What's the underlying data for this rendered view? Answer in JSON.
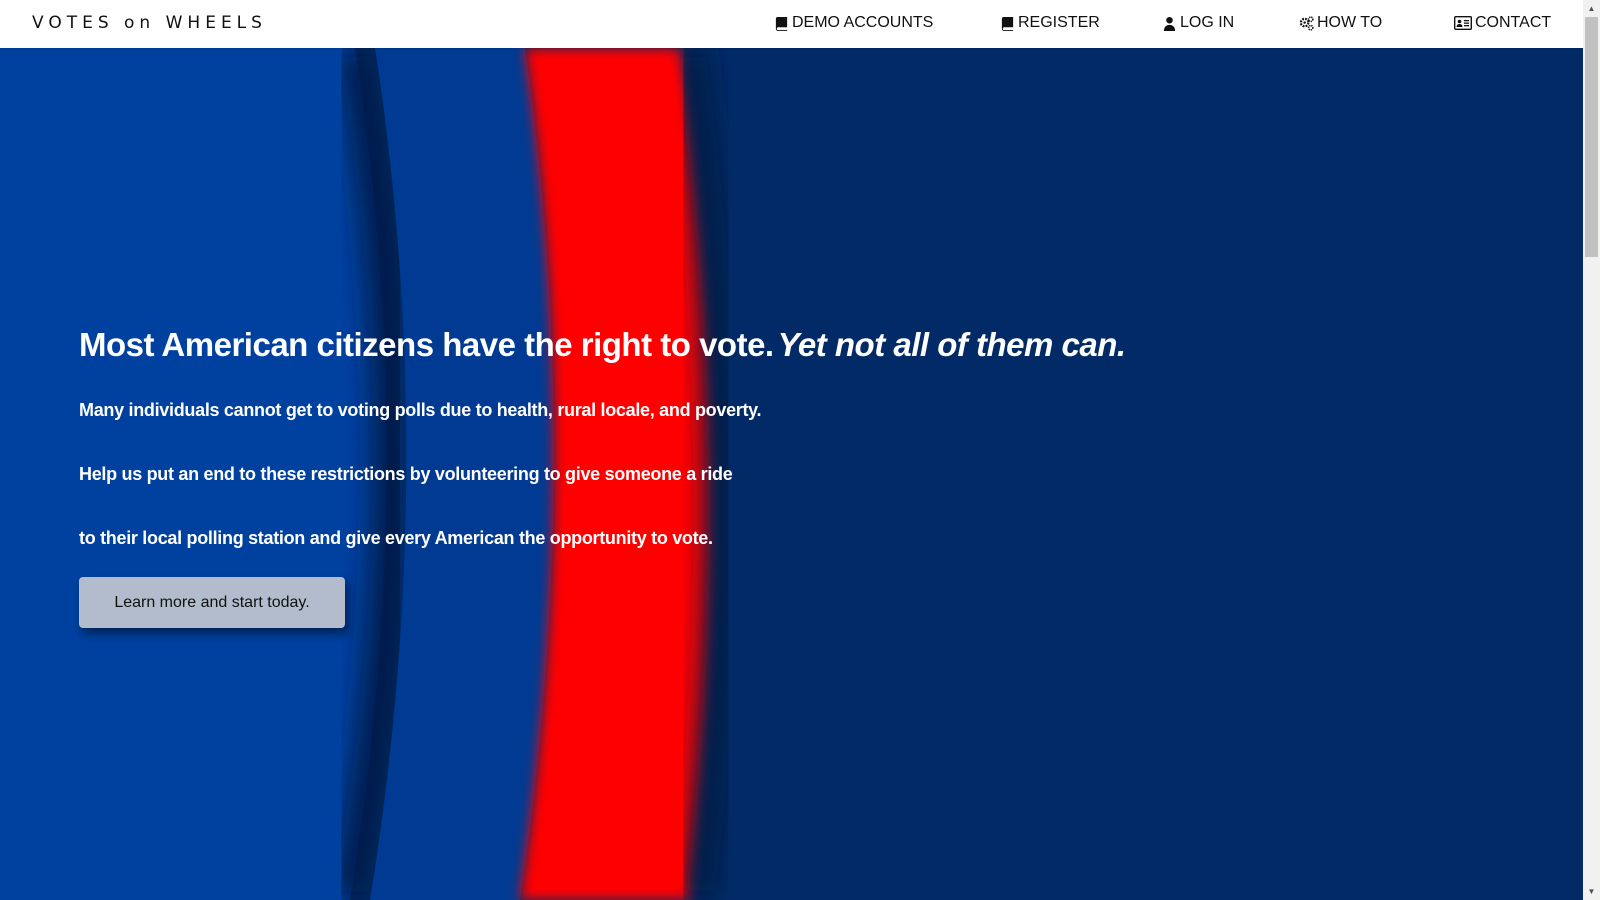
{
  "navbar": {
    "brand": "VOTES on WHEELS",
    "items": [
      {
        "label": "DEMO ACCOUNTS",
        "icon": "book-icon"
      },
      {
        "label": "REGISTER",
        "icon": "book-icon"
      },
      {
        "label": "LOG IN",
        "icon": "user-icon"
      },
      {
        "label": "HOW TO",
        "icon": "gears-icon"
      },
      {
        "label": "CONTACT",
        "icon": "address-card-icon"
      }
    ]
  },
  "hero": {
    "headline": "Most American citizens have the right to vote.",
    "headline_emphasis": "Yet not all of them can.",
    "paragraphs": [
      "Many individuals cannot get to voting polls due to health, rural locale, and poverty.",
      "Help us put an end to these restrictions by volunteering to give someone a ride",
      "to their local polling station and give every American the opportunity to vote."
    ],
    "cta_label": "Learn more and start today."
  },
  "colors": {
    "hero_background": "#012a66",
    "blue_band": "#0041a0",
    "red_band": "#ff0000",
    "button": "#b3bccd"
  }
}
